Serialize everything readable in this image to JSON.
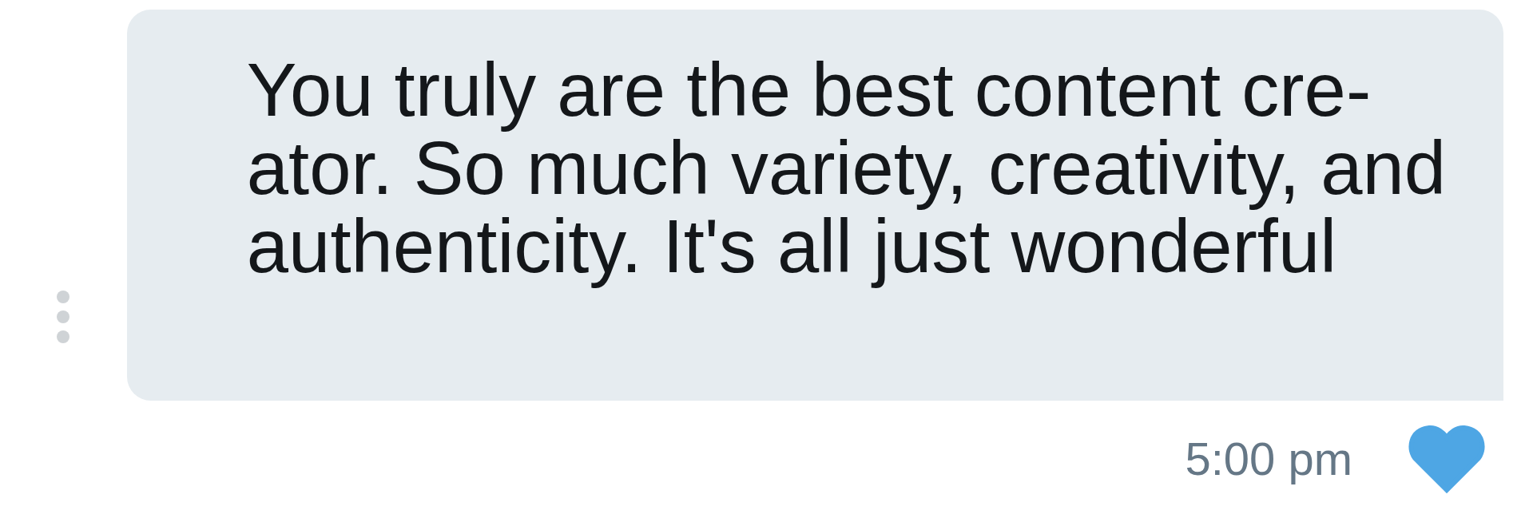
{
  "message": {
    "text": "You truly are the best content cre-\nator. So much variety, creativity, and\nauthenticity. It's all just wonderful",
    "liked": true,
    "time": "5:00 pm"
  }
}
